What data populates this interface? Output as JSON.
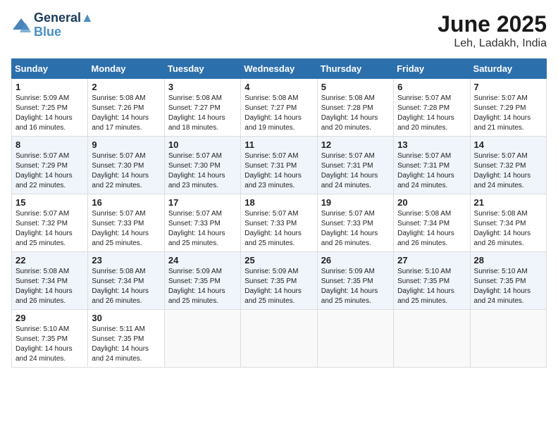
{
  "header": {
    "logo_line1": "General",
    "logo_line2": "Blue",
    "month": "June 2025",
    "location": "Leh, Ladakh, India"
  },
  "weekdays": [
    "Sunday",
    "Monday",
    "Tuesday",
    "Wednesday",
    "Thursday",
    "Friday",
    "Saturday"
  ],
  "weeks": [
    [
      {
        "day": "1",
        "sunrise": "5:09 AM",
        "sunset": "7:25 PM",
        "daylight": "14 hours and 16 minutes."
      },
      {
        "day": "2",
        "sunrise": "5:08 AM",
        "sunset": "7:26 PM",
        "daylight": "14 hours and 17 minutes."
      },
      {
        "day": "3",
        "sunrise": "5:08 AM",
        "sunset": "7:27 PM",
        "daylight": "14 hours and 18 minutes."
      },
      {
        "day": "4",
        "sunrise": "5:08 AM",
        "sunset": "7:27 PM",
        "daylight": "14 hours and 19 minutes."
      },
      {
        "day": "5",
        "sunrise": "5:08 AM",
        "sunset": "7:28 PM",
        "daylight": "14 hours and 20 minutes."
      },
      {
        "day": "6",
        "sunrise": "5:07 AM",
        "sunset": "7:28 PM",
        "daylight": "14 hours and 20 minutes."
      },
      {
        "day": "7",
        "sunrise": "5:07 AM",
        "sunset": "7:29 PM",
        "daylight": "14 hours and 21 minutes."
      }
    ],
    [
      {
        "day": "8",
        "sunrise": "5:07 AM",
        "sunset": "7:29 PM",
        "daylight": "14 hours and 22 minutes."
      },
      {
        "day": "9",
        "sunrise": "5:07 AM",
        "sunset": "7:30 PM",
        "daylight": "14 hours and 22 minutes."
      },
      {
        "day": "10",
        "sunrise": "5:07 AM",
        "sunset": "7:30 PM",
        "daylight": "14 hours and 23 minutes."
      },
      {
        "day": "11",
        "sunrise": "5:07 AM",
        "sunset": "7:31 PM",
        "daylight": "14 hours and 23 minutes."
      },
      {
        "day": "12",
        "sunrise": "5:07 AM",
        "sunset": "7:31 PM",
        "daylight": "14 hours and 24 minutes."
      },
      {
        "day": "13",
        "sunrise": "5:07 AM",
        "sunset": "7:31 PM",
        "daylight": "14 hours and 24 minutes."
      },
      {
        "day": "14",
        "sunrise": "5:07 AM",
        "sunset": "7:32 PM",
        "daylight": "14 hours and 24 minutes."
      }
    ],
    [
      {
        "day": "15",
        "sunrise": "5:07 AM",
        "sunset": "7:32 PM",
        "daylight": "14 hours and 25 minutes."
      },
      {
        "day": "16",
        "sunrise": "5:07 AM",
        "sunset": "7:33 PM",
        "daylight": "14 hours and 25 minutes."
      },
      {
        "day": "17",
        "sunrise": "5:07 AM",
        "sunset": "7:33 PM",
        "daylight": "14 hours and 25 minutes."
      },
      {
        "day": "18",
        "sunrise": "5:07 AM",
        "sunset": "7:33 PM",
        "daylight": "14 hours and 25 minutes."
      },
      {
        "day": "19",
        "sunrise": "5:07 AM",
        "sunset": "7:33 PM",
        "daylight": "14 hours and 26 minutes."
      },
      {
        "day": "20",
        "sunrise": "5:08 AM",
        "sunset": "7:34 PM",
        "daylight": "14 hours and 26 minutes."
      },
      {
        "day": "21",
        "sunrise": "5:08 AM",
        "sunset": "7:34 PM",
        "daylight": "14 hours and 26 minutes."
      }
    ],
    [
      {
        "day": "22",
        "sunrise": "5:08 AM",
        "sunset": "7:34 PM",
        "daylight": "14 hours and 26 minutes."
      },
      {
        "day": "23",
        "sunrise": "5:08 AM",
        "sunset": "7:34 PM",
        "daylight": "14 hours and 26 minutes."
      },
      {
        "day": "24",
        "sunrise": "5:09 AM",
        "sunset": "7:35 PM",
        "daylight": "14 hours and 25 minutes."
      },
      {
        "day": "25",
        "sunrise": "5:09 AM",
        "sunset": "7:35 PM",
        "daylight": "14 hours and 25 minutes."
      },
      {
        "day": "26",
        "sunrise": "5:09 AM",
        "sunset": "7:35 PM",
        "daylight": "14 hours and 25 minutes."
      },
      {
        "day": "27",
        "sunrise": "5:10 AM",
        "sunset": "7:35 PM",
        "daylight": "14 hours and 25 minutes."
      },
      {
        "day": "28",
        "sunrise": "5:10 AM",
        "sunset": "7:35 PM",
        "daylight": "14 hours and 24 minutes."
      }
    ],
    [
      {
        "day": "29",
        "sunrise": "5:10 AM",
        "sunset": "7:35 PM",
        "daylight": "14 hours and 24 minutes."
      },
      {
        "day": "30",
        "sunrise": "5:11 AM",
        "sunset": "7:35 PM",
        "daylight": "14 hours and 24 minutes."
      },
      null,
      null,
      null,
      null,
      null
    ]
  ]
}
